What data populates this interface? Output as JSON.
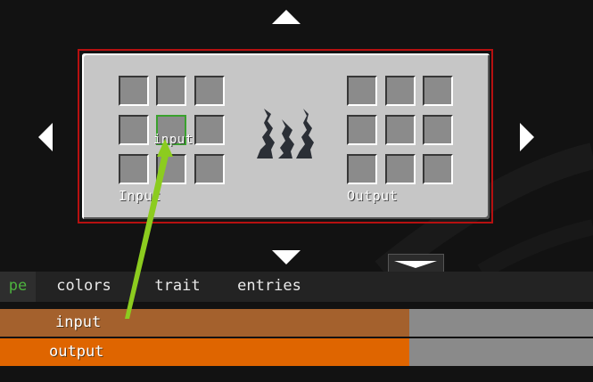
{
  "colors": {
    "background": "#121212",
    "frame_border": "#b61010",
    "panel": "#c6c6c6",
    "slot": "#8b8b8b",
    "selected_slot_border": "#3aa12e",
    "pointer_line": "#8ccc1f",
    "active_tab_text": "#4db33e",
    "row_input": "#a4612d",
    "row_output": "#df6500",
    "row_remainder": "#8a8a8a"
  },
  "nav": {
    "up_icon": "triangle-up",
    "down_icon": "triangle-down",
    "left_icon": "triangle-left",
    "right_icon": "triangle-right",
    "scroll_icon": "chevron-down"
  },
  "recipe": {
    "input_label": "Input",
    "output_label": "Output",
    "hover_label": "input",
    "flame_icon": "flames"
  },
  "tabs": [
    {
      "label": "pe",
      "active": true
    },
    {
      "label": "colors"
    },
    {
      "label": "trait"
    },
    {
      "label": "entries"
    }
  ],
  "entries": [
    {
      "label": "input",
      "fill_fraction": 0.69
    },
    {
      "label": "output",
      "fill_fraction": 0.69
    }
  ]
}
